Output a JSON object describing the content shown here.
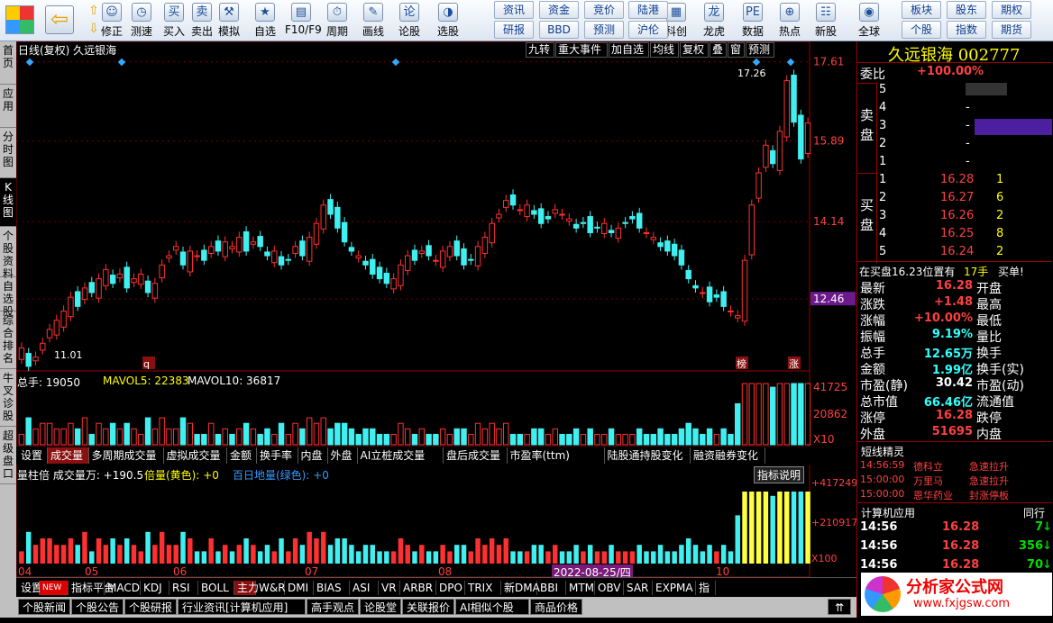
{
  "toolbar": {
    "items": [
      "修正",
      "测速",
      "买入",
      "卖出",
      "模拟",
      "自选",
      "F10/F9",
      "周期",
      "画线",
      "论股",
      "选股",
      "科创",
      "龙虎",
      "数据",
      "热点",
      "新股",
      "全球"
    ],
    "pairs": [
      [
        "资讯",
        "研报"
      ],
      [
        "资金",
        "BBD"
      ],
      [
        "竞价",
        "预测"
      ],
      [
        "陆港",
        "沪伦"
      ],
      [
        "板块",
        "个股"
      ],
      [
        "股东",
        "指数"
      ],
      [
        "期权",
        "期货"
      ]
    ]
  },
  "vtabs": [
    "首页",
    "应用",
    "分时图",
    "K线图",
    "个股资料",
    "自选股",
    "综合排名",
    "牛叉诊股",
    "超级盘口"
  ],
  "chart": {
    "title": "日线(复权)  久远银海",
    "header_buttons": [
      "九转",
      "重大事件",
      "加自选",
      "均线",
      "复权",
      "叠",
      "窗",
      "预测"
    ],
    "price_ticks": [
      "17.61",
      "15.89",
      "14.14",
      "12.46"
    ],
    "high_label": "17.26",
    "low_label": "11.01",
    "markers": [
      "榜",
      "涨",
      "q"
    ],
    "vol_legend": {
      "a": "总手: 19050",
      "b": "MAVOL5: 22383",
      "c": "MAVOL10: 36817"
    },
    "vol_ticks": [
      "41725",
      "20862",
      "X10"
    ],
    "tabs": [
      "设置",
      "成交量",
      "多周期成交量",
      "虚拟成交量",
      "金额",
      "换手率",
      "内盘",
      "外盘",
      "AI立桩成交量",
      "盘后成交量",
      "市盈率(ttm)",
      "陆股通持股变化",
      "融资融券变化"
    ],
    "ind2_legend": {
      "a": "量柱倍 成交量万: +190.5",
      "b": "倍量(黄色): +0",
      "c": "百日地量(绿色): +0"
    },
    "ind2_btn": "指标说明",
    "ind2_ticks": [
      "+417249",
      "+210917",
      "X100"
    ],
    "x_labels": [
      "04",
      "05",
      "06",
      "07",
      "08",
      "10"
    ],
    "cursor_date": "2022-08-25/四"
  },
  "chart_data": {
    "type": "candlestick",
    "title": "日线(复权) 久远银海",
    "ylim": [
      10.9,
      17.7
    ],
    "high": 17.26,
    "low": 11.01,
    "last": 16.28,
    "closes": [
      11.4,
      11.0,
      11.2,
      11.5,
      11.8,
      12.0,
      12.2,
      12.5,
      12.3,
      12.7,
      12.6,
      12.9,
      13.1,
      12.8,
      13.0,
      12.7,
      12.9,
      13.0,
      12.6,
      12.8,
      13.2,
      13.4,
      13.6,
      13.2,
      13.5,
      13.4,
      13.3,
      13.6,
      13.5,
      13.7,
      13.6,
      13.8,
      13.5,
      13.7,
      13.6,
      13.4,
      13.5,
      13.2,
      13.3,
      13.6,
      13.4,
      13.8,
      14.1,
      14.5,
      14.3,
      14.0,
      13.7,
      13.5,
      13.4,
      13.2,
      13.0,
      12.9,
      12.8,
      12.9,
      13.2,
      13.4,
      13.3,
      13.5,
      13.4,
      13.3,
      13.5,
      13.6,
      13.4,
      13.2,
      13.3,
      13.6,
      13.8,
      14.1,
      14.3,
      14.6,
      14.5,
      14.4,
      14.5,
      14.3,
      14.1,
      14.2,
      14.4,
      14.3,
      14.2,
      14.0,
      14.1,
      13.9,
      14.0,
      14.1,
      13.9,
      14.0,
      14.1,
      14.2,
      14.0,
      13.9,
      13.8,
      13.6,
      13.5,
      13.4,
      13.2,
      12.9,
      12.7,
      12.6,
      12.4,
      12.5,
      12.3,
      12.2,
      12.1,
      13.3,
      14.5,
      15.2,
      15.8,
      15.4,
      16.1,
      17.2,
      16.3,
      15.5,
      16.28
    ],
    "volume_max": 41725
  },
  "quote": {
    "name": "久远银海 002777",
    "wb_label": "委比",
    "wb_value": "+100.00%",
    "sell_label": "卖盘",
    "buy_label": "买盘",
    "sells": [
      [
        "5",
        "",
        "-"
      ],
      [
        "4",
        "",
        "-"
      ],
      [
        "3",
        "",
        "-"
      ],
      [
        "2",
        "",
        "-"
      ],
      [
        "1",
        "",
        "-"
      ]
    ],
    "buys": [
      [
        "1",
        "16.28",
        "1"
      ],
      [
        "2",
        "16.27",
        "6"
      ],
      [
        "3",
        "16.26",
        "2"
      ],
      [
        "4",
        "16.25",
        "8"
      ],
      [
        "5",
        "16.24",
        "2"
      ]
    ],
    "notice": "在买盘16.23位置有",
    "notice_qty": "17手",
    "notice_tail": "买单!",
    "stats": [
      [
        "最新",
        "16.28",
        "开盘",
        ""
      ],
      [
        "涨跌",
        "+1.48",
        "最高",
        ""
      ],
      [
        "涨幅",
        "+10.00%",
        "最低",
        ""
      ],
      [
        "振幅",
        "9.19%",
        "量比",
        ""
      ],
      [
        "总手",
        "12.65万",
        "换手",
        ""
      ],
      [
        "金额",
        "1.99亿",
        "换手(实)",
        ""
      ],
      [
        "市盈(静)",
        "30.42",
        "市盈(动)",
        ""
      ],
      [
        "总市值",
        "66.46亿",
        "流通值",
        ""
      ],
      [
        "涨停",
        "16.28",
        "跌停",
        ""
      ],
      [
        "外盘",
        "51695",
        "内盘",
        ""
      ]
    ],
    "spirit_title": "短线精灵",
    "spirits": [
      [
        "14:56:59",
        "德科立",
        "急速拉升"
      ],
      [
        "15:00:00",
        "万里马",
        "急速拉升"
      ],
      [
        "15:00:00",
        "恩华药业",
        "封涨停板"
      ]
    ],
    "tick_title": "计算机应用",
    "tick_tab": "同行",
    "ticks": [
      [
        "14:56",
        "16.28",
        "7"
      ],
      [
        "14:56",
        "16.28",
        "356"
      ],
      [
        "14:56",
        "16.28",
        "70"
      ]
    ],
    "watermark": "分析家公式网",
    "watermark_url": "www.fxjgsw.com"
  },
  "indicators": [
    "设置",
    "NEW",
    "指标平台",
    "MACD",
    "KDJ",
    "RSI",
    "BOLL",
    "主力",
    "W&R",
    "DMI",
    "BIAS",
    "ASI",
    "VR",
    "ARBR",
    "DPO",
    "TRIX",
    "新DMA",
    "BBI",
    "MTM",
    "OBV",
    "SAR",
    "EXPMA",
    "指"
  ],
  "news": [
    "个股新闻",
    "个股公告",
    "个股研报",
    "行业资讯[计算机应用]",
    "高手观点",
    "论股堂",
    "关联报价",
    "AI相似个股",
    "商品价格"
  ]
}
